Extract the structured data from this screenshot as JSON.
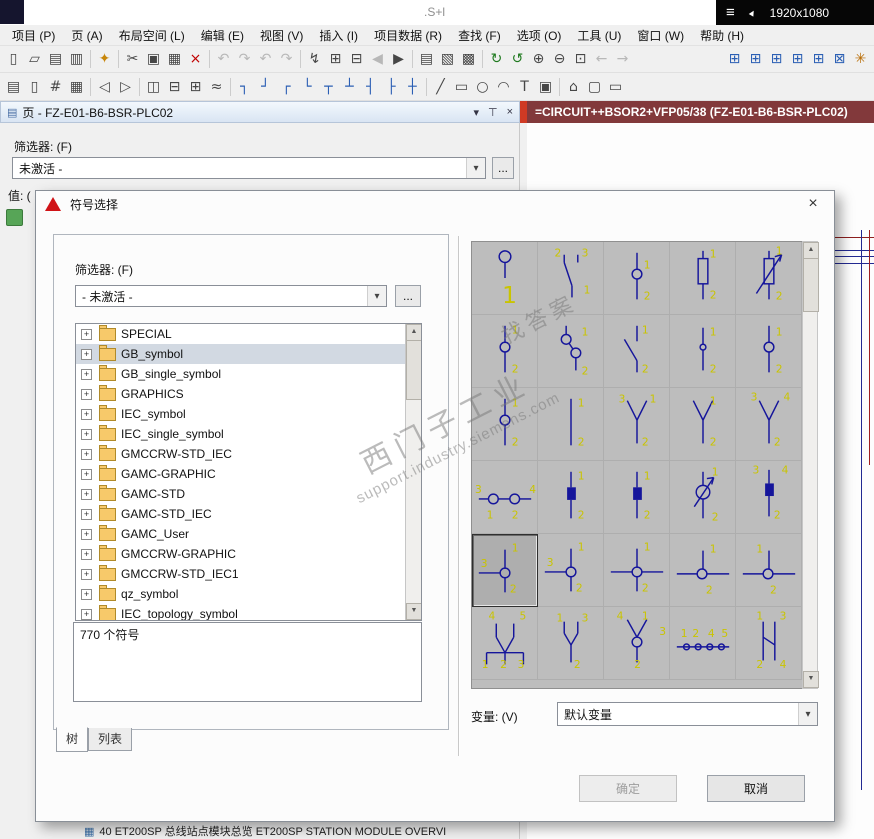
{
  "titlebar": {
    "fragment": ".S+l",
    "menu_glyph": "≡",
    "cursor_glyph": "►",
    "resolution": "1920x1080"
  },
  "menubar": {
    "items": [
      {
        "key": "project",
        "label": "项目 (P)"
      },
      {
        "key": "page",
        "label": "页 (A)"
      },
      {
        "key": "layout-space",
        "label": "布局空间 (L)"
      },
      {
        "key": "edit",
        "label": "编辑 (E)"
      },
      {
        "key": "view",
        "label": "视图 (V)"
      },
      {
        "key": "insert",
        "label": "插入 (I)"
      },
      {
        "key": "project-data",
        "label": "项目数据 (R)"
      },
      {
        "key": "find",
        "label": "查找 (F)"
      },
      {
        "key": "options",
        "label": "选项 (O)"
      },
      {
        "key": "utilities",
        "label": "工具 (U)"
      },
      {
        "key": "window",
        "label": "窗口 (W)"
      },
      {
        "key": "help",
        "label": "帮助 (H)"
      }
    ]
  },
  "toolbar1": {
    "icons": [
      {
        "n": "new-page-icon",
        "g": "▯"
      },
      {
        "n": "open-project-icon",
        "g": "▱"
      },
      {
        "n": "print-icon",
        "g": "▤"
      },
      {
        "n": "print-preview-icon",
        "g": "▥"
      },
      {
        "sep": true
      },
      {
        "n": "settings-wrench-icon",
        "g": "✦",
        "c": "#c8860a"
      },
      {
        "sep": true
      },
      {
        "n": "cut-icon",
        "g": "✂"
      },
      {
        "n": "copy-icon",
        "g": "▣"
      },
      {
        "n": "paste-icon",
        "g": "▦"
      },
      {
        "n": "delete-icon",
        "g": "×",
        "c": "#c00000"
      },
      {
        "sep": true
      },
      {
        "n": "undo-icon",
        "g": "↶",
        "d": true
      },
      {
        "n": "redo-icon",
        "g": "↷",
        "d": true
      },
      {
        "n": "undo-list-icon",
        "g": "↶",
        "d": true
      },
      {
        "n": "redo-list-icon",
        "g": "↷",
        "d": true
      },
      {
        "sep": true
      },
      {
        "n": "insert-symbol-icon",
        "g": "↯"
      },
      {
        "n": "insert-macro-icon",
        "g": "⊞"
      },
      {
        "n": "insert-window-macro-icon",
        "g": "⊟"
      },
      {
        "n": "prev-page-icon",
        "g": "◀",
        "d": true
      },
      {
        "n": "next-page-icon",
        "g": "▶"
      },
      {
        "sep": true
      },
      {
        "n": "list-view-icon",
        "g": "▤"
      },
      {
        "n": "graphic-preview-icon",
        "g": "▧"
      },
      {
        "n": "page-overview-icon",
        "g": "▩"
      },
      {
        "sep": true
      },
      {
        "n": "refresh-icon",
        "g": "↻",
        "c": "#1f7a1f"
      },
      {
        "n": "update-connections-icon",
        "g": "↺",
        "c": "#1f7a1f"
      },
      {
        "n": "zoom-in-icon",
        "g": "⊕"
      },
      {
        "n": "zoom-out-icon",
        "g": "⊖"
      },
      {
        "n": "zoom-window-icon",
        "g": "⊡"
      },
      {
        "n": "back-icon",
        "g": "←",
        "d": true
      },
      {
        "n": "forward-icon",
        "g": "→",
        "d": true
      }
    ],
    "right_icons": [
      {
        "n": "grid-display-icon",
        "g": "⊞",
        "c": "#2b5fb4"
      },
      {
        "n": "grid-size-a-icon",
        "g": "⊞",
        "c": "#2b5fb4"
      },
      {
        "n": "grid-size-b-icon",
        "g": "⊞",
        "c": "#2b5fb4"
      },
      {
        "n": "grid-size-c-icon",
        "g": "⊞",
        "c": "#2b5fb4"
      },
      {
        "n": "grid-size-d-icon",
        "g": "⊞",
        "c": "#2b5fb4"
      },
      {
        "n": "snap-to-grid-icon",
        "g": "⊠",
        "c": "#2b5fb4"
      },
      {
        "n": "design-mode-icon",
        "g": "✳",
        "c": "#b86a00"
      }
    ]
  },
  "toolbar2": {
    "icons": [
      {
        "n": "page-properties-icon",
        "g": "▤"
      },
      {
        "n": "new-subpage-icon",
        "g": "▯"
      },
      {
        "n": "page-numbering-icon",
        "g": "#"
      },
      {
        "n": "edit-properties-icon",
        "g": "▦"
      },
      {
        "sep": true
      },
      {
        "n": "previous-device-icon",
        "g": "◁"
      },
      {
        "n": "next-device-icon",
        "g": "▷"
      },
      {
        "sep": true
      },
      {
        "n": "device-navigator-icon",
        "g": "◫"
      },
      {
        "n": "terminal-strip-icon",
        "g": "⊟"
      },
      {
        "n": "plc-navigator-icon",
        "g": "⊞"
      },
      {
        "n": "cable-navigator-icon",
        "g": "≈"
      },
      {
        "sep": true
      },
      {
        "n": "connection-corner-ld-icon",
        "g": "┐",
        "c": "#2b5fb4"
      },
      {
        "n": "connection-corner-lu-icon",
        "g": "┘",
        "c": "#2b5fb4"
      },
      {
        "n": "connection-corner-rd-icon",
        "g": "┌",
        "c": "#2b5fb4"
      },
      {
        "n": "connection-corner-ru-icon",
        "g": "└",
        "c": "#2b5fb4"
      },
      {
        "n": "connection-t-down-icon",
        "g": "┬",
        "c": "#2b5fb4"
      },
      {
        "n": "connection-t-up-icon",
        "g": "┴",
        "c": "#2b5fb4"
      },
      {
        "n": "connection-t-left-icon",
        "g": "┤",
        "c": "#2b5fb4"
      },
      {
        "n": "connection-t-right-icon",
        "g": "├",
        "c": "#2b5fb4"
      },
      {
        "n": "connection-cross-icon",
        "g": "┼",
        "c": "#2b5fb4"
      },
      {
        "sep": true
      },
      {
        "n": "line-tool-icon",
        "g": "╱"
      },
      {
        "n": "rectangle-tool-icon",
        "g": "▭"
      },
      {
        "n": "circle-tool-icon",
        "g": "○"
      },
      {
        "n": "arc-tool-icon",
        "g": "◠"
      },
      {
        "n": "text-tool-icon",
        "g": "T"
      },
      {
        "n": "image-tool-icon",
        "g": "▣"
      },
      {
        "sep": true
      },
      {
        "n": "symbol-select-icon",
        "g": "⌂"
      },
      {
        "n": "device-box-icon",
        "g": "▢"
      },
      {
        "n": "structure-box-icon",
        "g": "▭"
      }
    ]
  },
  "left_panel": {
    "header": "页 - FZ-E01-B6-BSR-PLC02",
    "header_icon_glyph": "▤",
    "collapse_glyph": "▾",
    "pin_glyph": "⊤",
    "close_glyph": "×",
    "filter_label": "筛选器: (F)",
    "filter_value": "未激活 -",
    "browse_label": "...",
    "value_label": "值: ("
  },
  "editor_panel": {
    "header": "=CIRCUIT++BSOR2+VFP05/38 (FZ-E01-B6-BSR-PLC02)"
  },
  "dialog": {
    "title": "符号选择",
    "close_glyph": "×",
    "filter_label": "筛选器: (F)",
    "filter_value": "- 未激活 -",
    "browse_label": "...",
    "tree_expander": "+",
    "tree_items": [
      {
        "label": "SPECIAL"
      },
      {
        "label": "GB_symbol",
        "selected": true
      },
      {
        "label": "GB_single_symbol"
      },
      {
        "label": "GRAPHICS"
      },
      {
        "label": "IEC_symbol"
      },
      {
        "label": "IEC_single_symbol"
      },
      {
        "label": "GMCCRW-STD_IEC"
      },
      {
        "label": "GAMC-GRAPHIC"
      },
      {
        "label": "GAMC-STD"
      },
      {
        "label": "GAMC-STD_IEC"
      },
      {
        "label": "GAMC_User"
      },
      {
        "label": "GMCCRW-GRAPHIC"
      },
      {
        "label": "GMCCRW-STD_IEC1"
      },
      {
        "label": "qz_symbol"
      },
      {
        "label": "IEC_topology_symbol"
      }
    ],
    "count_text": "770 个符号",
    "tabs": [
      {
        "label": "树",
        "active": true
      },
      {
        "label": "列表",
        "active": false
      }
    ],
    "variant_label": "变量: (V)",
    "variant_value": "默认变量",
    "buttons": {
      "ok": "确定",
      "cancel": "取消"
    },
    "grid": {
      "symbol_color": "#15159b",
      "label_color": "#c9c400",
      "selected_index": 20,
      "cells": [
        {
          "v": "key",
          "labels": [
            [
              "1",
              30,
              62,
              "b"
            ]
          ]
        },
        {
          "v": "changeover",
          "labels": [
            [
              "2",
              16,
              14
            ],
            [
              "3",
              44,
              14
            ],
            [
              "1",
              46,
              52
            ]
          ]
        },
        {
          "v": "vcirc",
          "labels": [
            [
              "1",
              40,
              26
            ],
            [
              "2",
              40,
              58
            ]
          ]
        },
        {
          "v": "fuse",
          "labels": [
            [
              "1",
              40,
              15
            ],
            [
              "2",
              40,
              57
            ]
          ]
        },
        {
          "v": "fusearrow",
          "labels": [
            [
              "1",
              40,
              12
            ],
            [
              "2",
              40,
              58
            ]
          ]
        },
        {
          "v": "vcirc",
          "labels": [
            [
              "1",
              40,
              18
            ],
            [
              "2",
              40,
              58
            ]
          ]
        },
        {
          "v": "diagconn",
          "labels": [
            [
              "1",
              44,
              20
            ],
            [
              "2",
              44,
              60
            ]
          ]
        },
        {
          "v": "switch",
          "labels": [
            [
              "1",
              38,
              18
            ],
            [
              "2",
              38,
              58
            ]
          ]
        },
        {
          "v": "vcircs",
          "labels": [
            [
              "1",
              40,
              20
            ],
            [
              "2",
              40,
              58
            ]
          ]
        },
        {
          "v": "vcirc",
          "labels": [
            [
              "1",
              40,
              20
            ],
            [
              "2",
              40,
              58
            ]
          ]
        },
        {
          "v": "vcirc",
          "labels": [
            [
              "1",
              40,
              18
            ],
            [
              "2",
              40,
              58
            ]
          ]
        },
        {
          "v": "vline",
          "labels": [
            [
              "1",
              40,
              18
            ],
            [
              "2",
              40,
              58
            ]
          ]
        },
        {
          "v": "yfork",
          "labels": [
            [
              "3",
              14,
              14
            ],
            [
              "1",
              46,
              14
            ],
            [
              "2",
              38,
              58
            ]
          ]
        },
        {
          "v": "yfork",
          "labels": [
            [
              "1",
              40,
              16
            ],
            [
              "2",
              40,
              58
            ]
          ]
        },
        {
          "v": "yfork",
          "labels": [
            [
              "3",
              14,
              12
            ],
            [
              "4",
              48,
              12
            ],
            [
              "2",
              38,
              58
            ]
          ]
        },
        {
          "v": "h2circ",
          "labels": [
            [
              "3",
              2,
              32
            ],
            [
              "4",
              58,
              32
            ],
            [
              "1",
              14,
              58
            ],
            [
              "2",
              40,
              58
            ]
          ]
        },
        {
          "v": "vblock",
          "labels": [
            [
              "1",
              40,
              18
            ],
            [
              "2",
              40,
              58
            ]
          ]
        },
        {
          "v": "vblock",
          "labels": [
            [
              "1",
              40,
              18
            ],
            [
              "2",
              40,
              58
            ]
          ]
        },
        {
          "v": "circarrow",
          "labels": [
            [
              "1",
              42,
              14
            ],
            [
              "2",
              42,
              60
            ]
          ]
        },
        {
          "v": "vblock2",
          "labels": [
            [
              "3",
              16,
              12
            ],
            [
              "4",
              46,
              12
            ],
            [
              "2",
              38,
              58
            ]
          ]
        },
        {
          "v": "teecirc",
          "labels": [
            [
              "1",
              40,
              16
            ],
            [
              "3",
              8,
              32
            ],
            [
              "2",
              38,
              58
            ]
          ]
        },
        {
          "v": "teecirc",
          "labels": [
            [
              "3",
              8,
              32
            ],
            [
              "1",
              40,
              16
            ],
            [
              "2",
              38,
              58
            ]
          ]
        },
        {
          "v": "crosscirc",
          "labels": [
            [
              "1",
              40,
              16
            ],
            [
              "2",
              38,
              58
            ]
          ]
        },
        {
          "v": "hcirc",
          "labels": [
            [
              "1",
              40,
              18
            ],
            [
              "2",
              36,
              60
            ]
          ]
        },
        {
          "v": "hcirc",
          "labels": [
            [
              "1",
              20,
              18
            ],
            [
              "2",
              34,
              60
            ]
          ]
        },
        {
          "v": "multi3",
          "labels": [
            [
              "4",
              16,
              12
            ],
            [
              "5",
              48,
              12
            ],
            [
              "1",
              9,
              62
            ],
            [
              "2",
              28,
              62
            ],
            [
              "3",
              46,
              62
            ]
          ]
        },
        {
          "v": "fork2",
          "labels": [
            [
              "1",
              18,
              14
            ],
            [
              "3",
              44,
              14
            ],
            [
              "2",
              36,
              62
            ]
          ]
        },
        {
          "v": "yforkcirc",
          "labels": [
            [
              "4",
              12,
              12
            ],
            [
              "1",
              38,
              12
            ],
            [
              "3",
              56,
              28
            ],
            [
              "2",
              30,
              62
            ]
          ]
        },
        {
          "v": "hterm",
          "labels": [
            [
              "1",
              10,
              30
            ],
            [
              "2",
              22,
              30
            ],
            [
              "4",
              38,
              30
            ],
            [
              "5",
              52,
              30
            ]
          ]
        },
        {
          "v": "fork2x2",
          "labels": [
            [
              "1",
              20,
              12
            ],
            [
              "3",
              44,
              12
            ],
            [
              "2",
              20,
              62
            ],
            [
              "4",
              44,
              62
            ]
          ]
        }
      ]
    }
  },
  "watermark": {
    "text_cn": "西门子工业",
    "text_url": "support.industry.siemens.com",
    "text_extra": "找答案"
  },
  "status_row": {
    "icon_glyph": "▦",
    "text": "40 ET200SP 总线站点模块总览 ET200SP STATION MODULE OVERVI"
  }
}
